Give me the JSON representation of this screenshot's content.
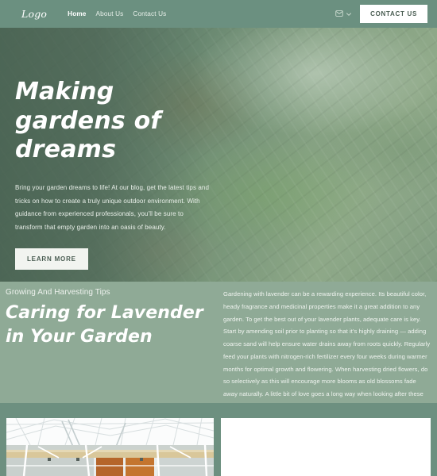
{
  "theme": {
    "header_bg": "#6b9080",
    "section_bg": "#8faa96",
    "gallery_bg": "#6d9080",
    "button_bg": "#ffffff",
    "button_text": "#4a5d52",
    "heading_text": "#ffffff"
  },
  "header": {
    "logo": "Logo",
    "nav": [
      {
        "label": "Home",
        "active": true
      },
      {
        "label": "About Us",
        "active": false
      },
      {
        "label": "Contact Us",
        "active": false
      }
    ],
    "language_icon": "globe-icon",
    "language_chevron": "chevron-down-icon",
    "cta_label": "CONTACT US"
  },
  "hero": {
    "title": "Making gardens of dreams",
    "paragraph": "Bring your garden dreams to life! At our blog, get the latest tips and tricks on how to create a truly unique outdoor environment. With guidance from experienced professionals, you'll be sure to transform that empty garden into an oasis of beauty.",
    "cta_label": "LEARN MORE",
    "image_alt": "succulent-echeveria-plants-photo"
  },
  "article": {
    "eyebrow": "Growing And Harvesting Tips",
    "title": "Caring for Lavender in Your Garden",
    "body": "Gardening with lavender can be a rewarding experience. Its beautiful color, heady fragrance and medicinal properties make it a great addition to any garden. To get the best out of your lavender plants, adequate care is key. Start by amending soil prior to planting so that it's highly draining — adding coarse sand will help ensure water drains away from roots quickly. Regularly feed your plants with nitrogen-rich fertilizer every four weeks during warmer months for optimal growth and flowering. When harvesting dried flowers, do so selectively as this will encourage more blooms as old blossoms fade away naturally. A little bit of love goes a long way when looking after these fragrant flowering shrubs!"
  },
  "gallery": {
    "left_image_alt": "greenhouse-interior-glass-roof-photo",
    "right_card_alt": "blank-white-card"
  }
}
